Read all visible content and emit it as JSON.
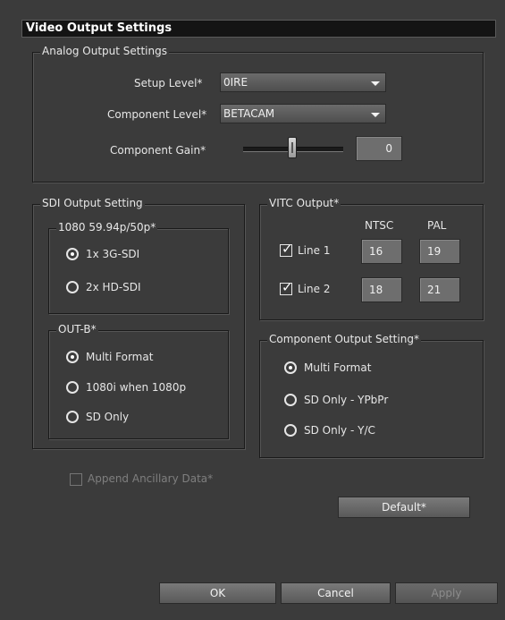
{
  "window": {
    "title": "Video Output Settings"
  },
  "analog": {
    "legend": "Analog Output Settings",
    "setup_level_label": "Setup Level*",
    "setup_level_value": "0IRE",
    "component_level_label": "Component Level*",
    "component_level_value": "BETACAM",
    "component_gain_label": "Component Gain*",
    "component_gain_value": "0",
    "component_gain_slider_level": 0.5
  },
  "sdi": {
    "legend": "SDI Output Setting",
    "p1080": {
      "legend": "1080 59.94p/50p*",
      "options": [
        {
          "label": "1x 3G-SDI",
          "selected": true
        },
        {
          "label": "2x HD-SDI",
          "selected": false
        }
      ]
    },
    "outb": {
      "legend": "OUT-B*",
      "options": [
        {
          "label": "Multi Format",
          "selected": true
        },
        {
          "label": "1080i when 1080p",
          "selected": false
        },
        {
          "label": "SD Only",
          "selected": false
        }
      ]
    }
  },
  "vitc": {
    "legend": "VITC Output*",
    "col_ntsc": "NTSC",
    "col_pal": "PAL",
    "rows": [
      {
        "label": "Line 1",
        "checked": true,
        "ntsc": "16",
        "pal": "19"
      },
      {
        "label": "Line 2",
        "checked": true,
        "ntsc": "18",
        "pal": "21"
      }
    ]
  },
  "component_output": {
    "legend": "Component Output Setting*",
    "options": [
      {
        "label": "Multi Format",
        "selected": true
      },
      {
        "label": "SD Only - YPbPr",
        "selected": false
      },
      {
        "label": "SD Only - Y/C",
        "selected": false
      }
    ]
  },
  "append_ancillary": {
    "label": "Append Ancillary Data*",
    "checked": false,
    "enabled": false
  },
  "buttons": {
    "default": "Default*",
    "ok": "OK",
    "cancel": "Cancel",
    "apply": "Apply"
  }
}
